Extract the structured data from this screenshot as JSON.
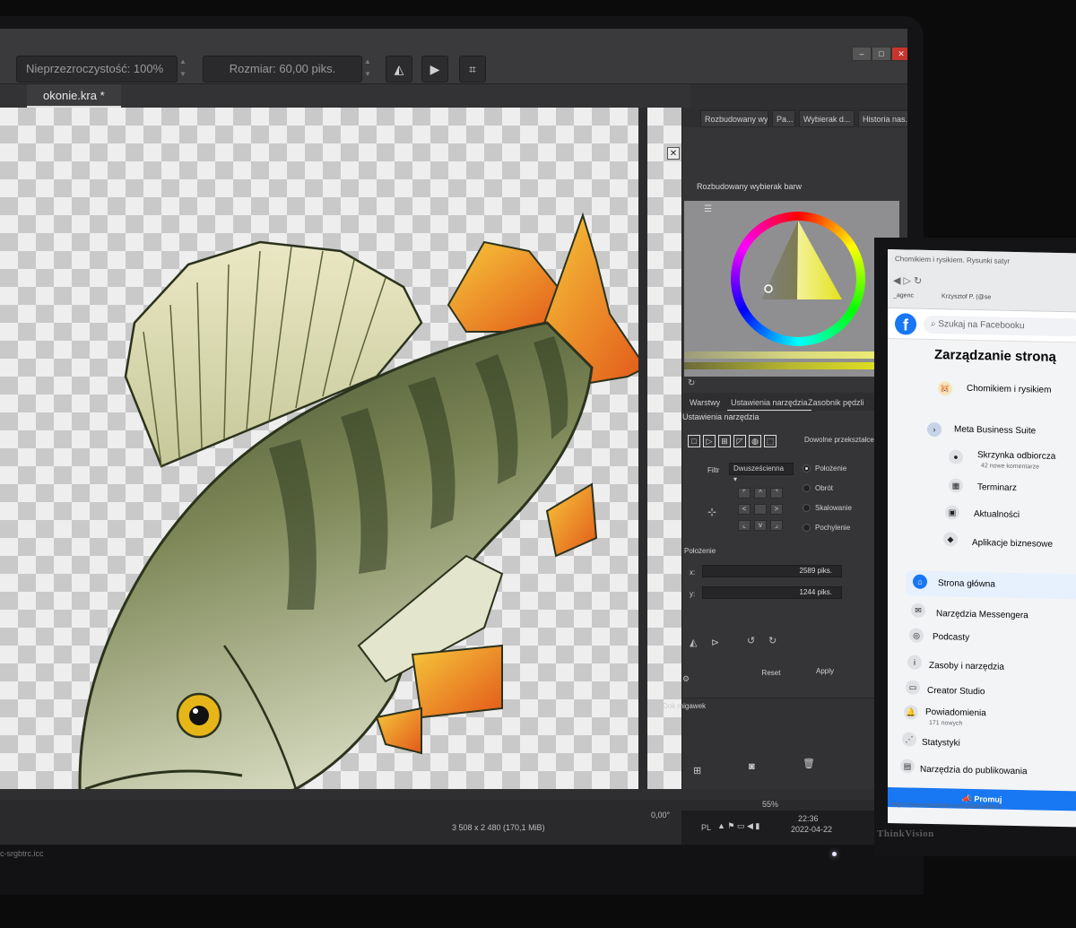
{
  "krita": {
    "toolbar": {
      "opacity_label": "Nieprzezroczystość: 100%",
      "size_label": "Rozmiar: 60,00 piks."
    },
    "document_tab": "okonie.kra *",
    "dockers": {
      "top_tabs": [
        "Rozbudowany wyb...",
        "Pa...",
        "Wybierak d...",
        "Historia nas..."
      ],
      "color_selector_title": "Rozbudowany wybierak barw",
      "tool_tabs": [
        "Warstwy",
        "Ustawienia narzędzia",
        "Zasobnik pędzli"
      ],
      "tool_options_title": "Ustawienia narzędzia",
      "transform_mode": "Dowolne przekształcenie",
      "filter_label": "Filtr",
      "filter_value": "Dwusześcienna",
      "modes": [
        "Położenie",
        "Obrót",
        "Skalowanie",
        "Pochylenie"
      ],
      "position_section": "Położenie",
      "x_label": "x:",
      "x_value": "2589 piks.",
      "y_label": "y:",
      "y_value": "1244 piks.",
      "reset_label": "Reset",
      "apply_label": "Apply",
      "snapshot_docker": "Dok migawek"
    },
    "status": {
      "image_size": "3 508 x 2 480 (170,1 MiB)",
      "rotation": "0,00°",
      "zoom": "55%",
      "color_profile": "c-srgbtrc.icc",
      "language": "PL",
      "time": "22:36",
      "date": "2022-04-22"
    }
  },
  "facebook": {
    "browser_tab": "Chomikiem i rysikiem. Rysunki satyr",
    "bookmarks": [
      "_agenc",
      "Krzysztof P. (@se"
    ],
    "search_placeholder": "Szukaj na Facebooku",
    "page_heading": "Zarządzanie stroną",
    "page_name": "Chomikiem i rysikiem",
    "meta_suite": "Meta Business Suite",
    "inbox": "Skrzynka odbiorcza",
    "inbox_sub": "42 nowe komentarze",
    "planner": "Terminarz",
    "news": "Aktualności",
    "business_apps": "Aplikacje biznesowe",
    "home": "Strona główna",
    "messenger_tools": "Narzędzia Messengera",
    "podcasts": "Podcasty",
    "resources": "Zasoby i narzędzia",
    "creator_studio": "Creator Studio",
    "notifications": "Powiadomienia",
    "notifications_sub": "171 nowych",
    "stats": "Statystyki",
    "publishing_tools": "Narzędzia do publikowania",
    "promote": "Promuj",
    "status_url": "https://www.facebook.com/publications/"
  },
  "hardware": {
    "brand": "ThinkVision"
  }
}
